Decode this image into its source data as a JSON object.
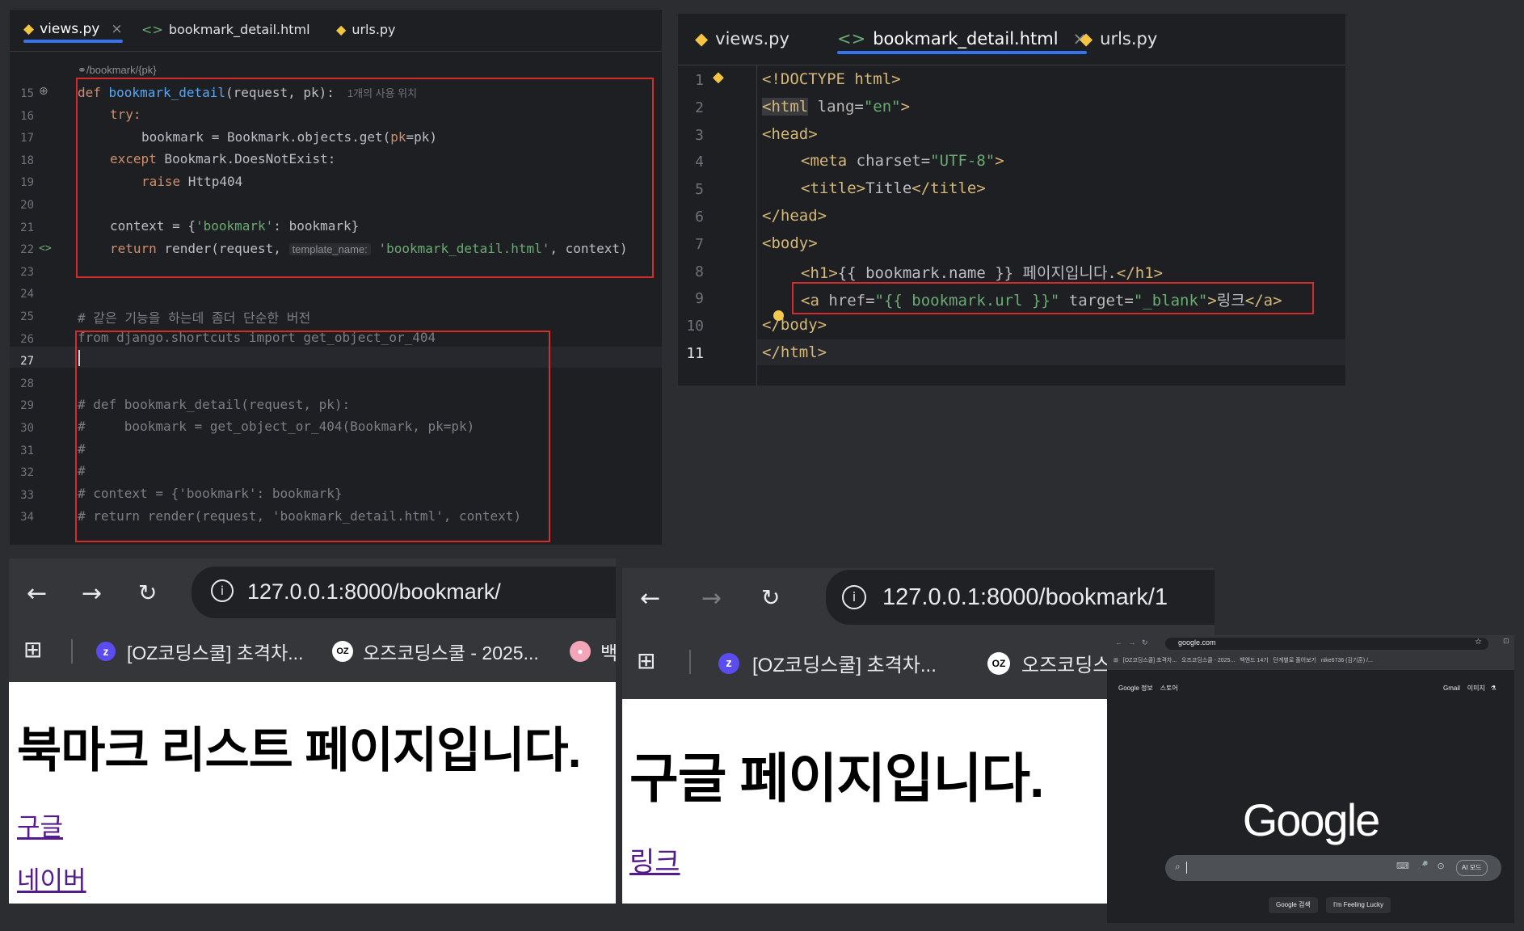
{
  "left_editor": {
    "tabs": [
      "views.py",
      "bookmark_detail.html",
      "urls.py"
    ],
    "tab_close": "×",
    "breadcrumb": "/bookmark/{pk}",
    "line_numbers": [
      "15",
      "16",
      "17",
      "18",
      "19",
      "20",
      "21",
      "22",
      "23",
      "24",
      "25",
      "26",
      "27",
      "28",
      "29",
      "30",
      "31",
      "32",
      "33",
      "34"
    ],
    "usage_hint": "1개의 사용 위치",
    "param_hint": "template_name:",
    "code": {
      "l15_def": "def ",
      "l15_fn": "bookmark_detail",
      "l15_rest": "(request, pk):",
      "l16": "try:",
      "l17_a": "bookmark = Bookmark.objects.get(",
      "l17_pk": "pk",
      "l17_b": "=pk)",
      "l18_a": "except",
      "l18_b": " Bookmark.DoesNotExist:",
      "l19_a": "raise",
      "l19_b": " Http404",
      "l21_a": "context = {",
      "l21_str": "'bookmark'",
      "l21_b": ": bookmark}",
      "l22_a": "return",
      "l22_b": " render(request, ",
      "l22_str": "'bookmark_detail.html'",
      "l22_c": ", context)",
      "l25": "# 같은 기능을 하는데 좀더 단순한 버전",
      "l26": "from django.shortcuts import get_object_or_404",
      "l29": "# def bookmark_detail(request, pk):",
      "l30": "#     bookmark = get_object_or_404(Bookmark, pk=pk)",
      "l31": "#",
      "l32": "#",
      "l33": "# context = {'bookmark': bookmark}",
      "l34": "# return render(request, 'bookmark_detail.html', context)"
    }
  },
  "right_editor": {
    "tabs": [
      "views.py",
      "bookmark_detail.html",
      "urls.py"
    ],
    "tab_close": "×",
    "line_numbers": [
      "1",
      "2",
      "3",
      "4",
      "5",
      "6",
      "7",
      "8",
      "9",
      "10",
      "11"
    ],
    "code": {
      "l1": "<!DOCTYPE html>",
      "l2_tag": "<html",
      "l2_attr": " lang=",
      "l2_val": "\"en\"",
      "l2_end": ">",
      "l3": "<head>",
      "l4_tag": "<meta",
      "l4_attr": " charset=",
      "l4_val": "\"UTF-8\"",
      "l4_end": ">",
      "l5_open": "<title>",
      "l5_text": "Title",
      "l5_close": "</title>",
      "l6": "</head>",
      "l7": "<body>",
      "l8_open": "<h1>",
      "l8_text": "{{ bookmark.name }} 페이지입니다.",
      "l8_close": "</h1>",
      "l9_tag": "<a",
      "l9_attr1": " href=",
      "l9_val1": "\"{{ bookmark.url }}\"",
      "l9_attr2": " target=",
      "l9_val2": "\"_blank\"",
      "l9_gt": ">",
      "l9_text": "링크",
      "l9_close": "</a>",
      "l10": "</body>",
      "l11": "</html>"
    }
  },
  "browser_list": {
    "url": "127.0.0.1:8000/bookmark/",
    "bookmarks": [
      "[OZ코딩스쿨] 초격차...",
      "오즈코딩스쿨 - 2025...",
      "백"
    ],
    "heading": "북마크 리스트 페이지입니다.",
    "links": [
      "구글",
      "네이버"
    ]
  },
  "browser_detail": {
    "url": "127.0.0.1:8000/bookmark/1",
    "bookmarks": [
      "[OZ코딩스쿨] 초격차...",
      "오즈코딩스"
    ],
    "heading": "구글 페이지입니다.",
    "link": "링크"
  },
  "google_window": {
    "url": "google.com",
    "bookmarks": [
      "[OZ코딩스쿨] 초격차...",
      "오즈코딩스쿨 - 2025...",
      "백엔드 14기",
      "단계별로 풀어보기",
      "nike6736 (김기훈) /..."
    ],
    "top_left": [
      "Google 정보",
      "스토어"
    ],
    "top_right": [
      "Gmail",
      "이미지"
    ],
    "logo": "Google",
    "search_chip": "AI 모드",
    "buttons": [
      "Google 검색",
      "I'm Feeling Lucky"
    ]
  },
  "colors": {
    "accent_blue": "#3574f0",
    "annotation_red": "#d22d2d",
    "visited_link": "#551a8b"
  }
}
